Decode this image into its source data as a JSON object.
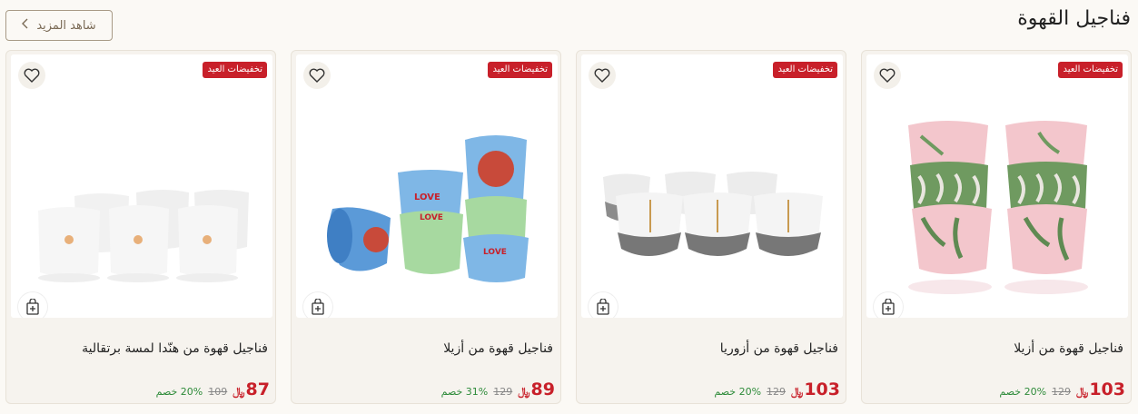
{
  "section": {
    "title": "فناجيل القهوة",
    "see_more": "شاهد المزيد"
  },
  "colors": {
    "accent": "#c8202a",
    "discount": "#2e8b3a",
    "card_bg": "#f6f3ee"
  },
  "products": [
    {
      "badge": "تخفيضات العيد",
      "name": "فناجيل قهوة من أزيلا",
      "price": "103",
      "currency": "﷼",
      "old_price": "129",
      "discount": "20% خصم"
    },
    {
      "badge": "تخفيضات العيد",
      "name": "فناجيل قهوة من أزوريا",
      "price": "103",
      "currency": "﷼",
      "old_price": "129",
      "discount": "20% خصم"
    },
    {
      "badge": "تخفيضات العيد",
      "name": "فناجيل قهوة من أزيلا",
      "price": "89",
      "currency": "﷼",
      "old_price": "129",
      "discount": "31% خصم"
    },
    {
      "badge": "تخفيضات العيد",
      "name": "فناجيل قهوة من هنّدا لمسة برتقالية",
      "price": "87",
      "currency": "﷼",
      "old_price": "109",
      "discount": "20% خصم"
    }
  ],
  "icons": {
    "heart": "heart-icon",
    "cart": "add-to-bag-icon",
    "chevron": "chevron-left-icon"
  }
}
